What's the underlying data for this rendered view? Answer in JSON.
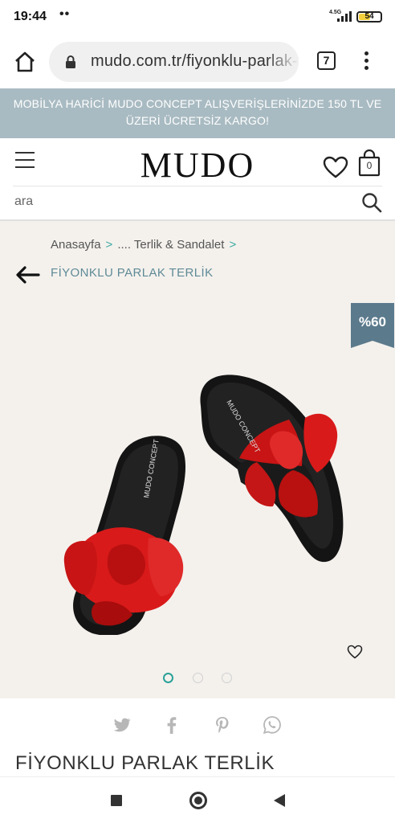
{
  "status_bar": {
    "time": "19:44",
    "notif_dots": "••",
    "network": "4.5G",
    "battery": "54",
    "battery_level": 0.54
  },
  "browser": {
    "url": "mudo.com.tr/fiyonklu-parlak-terlik",
    "tab_count": "7",
    "icons": [
      "home-icon",
      "lock-icon",
      "tabs-icon",
      "more-vert-icon"
    ]
  },
  "promo": {
    "text": "MOBİLYA HARİCİ MUDO CONCEPT ALIŞVERİŞLERİNİZDE 150 TL VE ÜZERİ ÜCRETSİZ KARGO!"
  },
  "header": {
    "logo": "MUDO",
    "cart_count": "0",
    "icons": [
      "menu-icon",
      "heart-icon",
      "bag-icon"
    ]
  },
  "search": {
    "placeholder": "ara"
  },
  "breadcrumb": {
    "items": [
      "Anasayfa",
      ".... Terlik & Sandalet"
    ],
    "separator": ">",
    "current": "FİYONKLU PARLAK TERLİK"
  },
  "product": {
    "discount": "%60",
    "image_dots": 3,
    "active_dot": 0,
    "title": "FİYONKLU PARLAK TERLİK",
    "sole_text": "MUDO CONCEPT",
    "share_icons": [
      "twitter-icon",
      "facebook-icon",
      "pinterest-icon",
      "whatsapp-icon"
    ]
  },
  "colors": {
    "banner": "#a9bbc2",
    "accent": "#2aa198",
    "badge": "#5b7a8c",
    "page_bg": "#f4f1ed",
    "bow_red": "#d91a1a"
  },
  "nav_bar": {
    "icons": [
      "recents-icon",
      "home-circle-icon",
      "back-triangle-icon"
    ]
  }
}
